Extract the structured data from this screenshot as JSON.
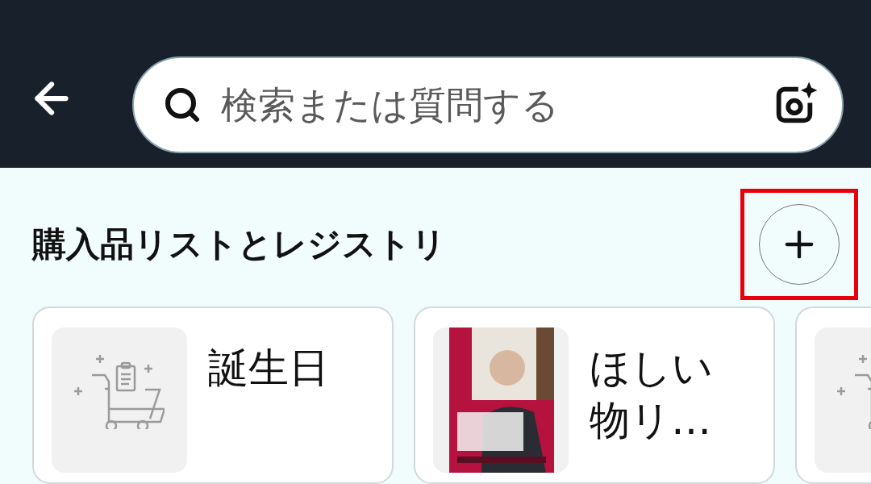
{
  "header": {
    "search": {
      "placeholder": "検索または質問する"
    }
  },
  "section": {
    "title": "購入品リストとレジストリ",
    "add_button": {
      "highlighted": true
    }
  },
  "lists": [
    {
      "title": "誕生日",
      "kind": "placeholder"
    },
    {
      "title": "ほしい物リ…",
      "kind": "picture"
    },
    {
      "kind": "placeholder"
    }
  ]
}
